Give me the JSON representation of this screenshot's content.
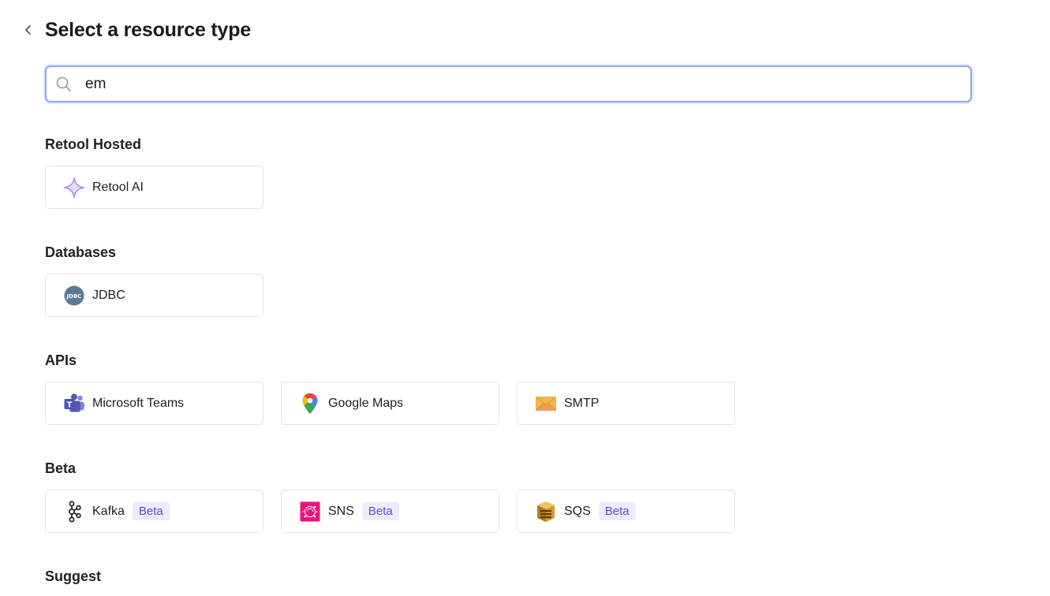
{
  "header": {
    "title": "Select a resource type"
  },
  "search": {
    "value": "em"
  },
  "sections": [
    {
      "title": "Retool Hosted",
      "items": [
        {
          "label": "Retool AI",
          "icon": "retool-ai-sparkle-icon"
        }
      ]
    },
    {
      "title": "Databases",
      "items": [
        {
          "label": "JDBC",
          "icon": "jdbc-icon",
          "icon_text": "JDBC"
        }
      ]
    },
    {
      "title": "APIs",
      "items": [
        {
          "label": "Microsoft Teams",
          "icon": "microsoft-teams-icon",
          "icon_text": "T"
        },
        {
          "label": "Google Maps",
          "icon": "google-maps-pin-icon"
        },
        {
          "label": "SMTP",
          "icon": "envelope-icon"
        }
      ]
    },
    {
      "title": "Beta",
      "items": [
        {
          "label": "Kafka",
          "icon": "kafka-icon",
          "badge": "Beta"
        },
        {
          "label": "SNS",
          "icon": "aws-sns-icon",
          "badge": "Beta"
        },
        {
          "label": "SQS",
          "icon": "aws-sqs-icon",
          "badge": "Beta"
        }
      ]
    },
    {
      "title": "Suggest",
      "items": []
    }
  ],
  "colors": {
    "focus_ring": "#8ea8f2",
    "badge_bg": "#eceafc",
    "badge_text": "#5a4fd0",
    "sparkle": "#a98be6",
    "jdbc": "#5b7a95",
    "teams": "#5558af",
    "sns": "#e7157b",
    "sqs": "#d49a2a",
    "smtp": "#f0b64a"
  }
}
